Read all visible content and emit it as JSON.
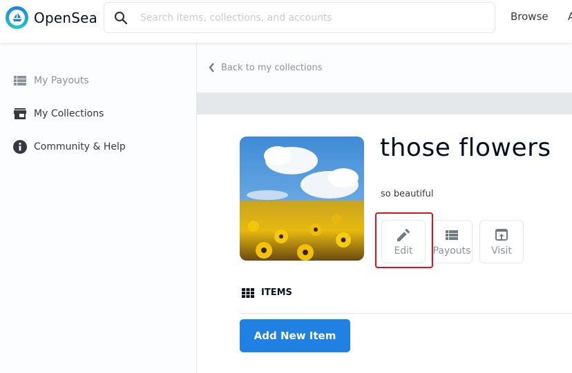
{
  "header": {
    "brand": "OpenSea",
    "search_placeholder": "Search items, collections, and accounts",
    "search_value": "",
    "nav": [
      "Browse",
      "A"
    ]
  },
  "sidebar": {
    "items": [
      {
        "label": "My Payouts",
        "icon": "list-icon"
      },
      {
        "label": "My Collections",
        "icon": "storefront-icon"
      },
      {
        "label": "Community & Help",
        "icon": "info-icon"
      }
    ]
  },
  "main": {
    "back_label": "Back to my collections",
    "collection": {
      "title": "those flowers",
      "description": "so beautiful",
      "image_alt": "field of yellow flowers under blue sky with clouds"
    },
    "actions": [
      {
        "label": "Edit",
        "icon": "pencil-icon"
      },
      {
        "label": "Payouts",
        "icon": "list-icon"
      },
      {
        "label": "Visit",
        "icon": "open-external-icon"
      }
    ],
    "items_header": "ITEMS",
    "add_item_label": "Add New Item"
  },
  "colors": {
    "accent": "#2081e2",
    "highlight": "#e3101b"
  }
}
